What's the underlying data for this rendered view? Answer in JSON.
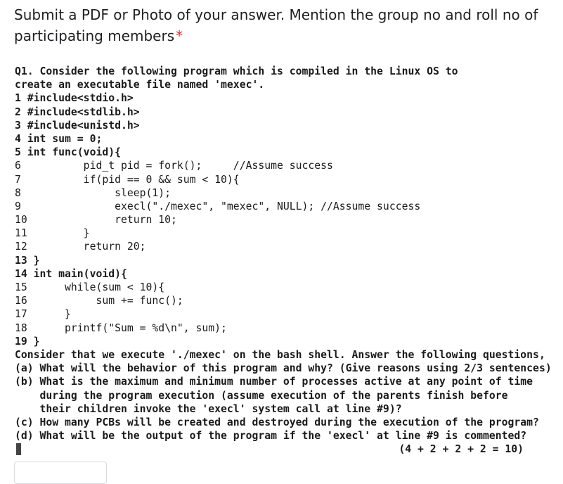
{
  "question": {
    "title_line1": "Submit a PDF or Photo of your answer. Mention the group no and roll no of",
    "title_line2": "participating members",
    "required_mark": "*"
  },
  "code_lines": [
    "Q1. Consider the following program which is compiled in the Linux OS to",
    "create an executable file named 'mexec'.",
    "1 #include<stdio.h>",
    "2 #include<stdlib.h>",
    "3 #include<unistd.h>",
    "4 int sum = 0;",
    "5 int func(void){",
    "6          pid_t pid = fork();     //Assume success",
    "7          if(pid == 0 && sum < 10){",
    "8               sleep(1);",
    "9               execl(\"./mexec\", \"mexec\", NULL); //Assume success",
    "10              return 10;",
    "11         }",
    "12         return 20;",
    "13 }",
    "14 int main(void){",
    "15      while(sum < 10){",
    "16           sum += func();",
    "17      }",
    "18      printf(\"Sum = %d\\n\", sum);",
    "19 }",
    "Consider that we execute './mexec' on the bash shell. Answer the following questions,",
    "(a) What will the behavior of this program and why? (Give reasons using 2/3 sentences)",
    "(b) What is the maximum and minimum number of processes active at any point of time",
    "    during the program execution (assume execution of the parents finish before",
    "    their children invoke the 'execl' system call at line #9)?",
    "(c) How many PCBs will be created and destroyed during the execution of the program?",
    "(d) What will be the output of the program if the 'execl' at line #9 is commented?"
  ],
  "score_line": "(4 + 2 + 2 + 2 = 10)"
}
